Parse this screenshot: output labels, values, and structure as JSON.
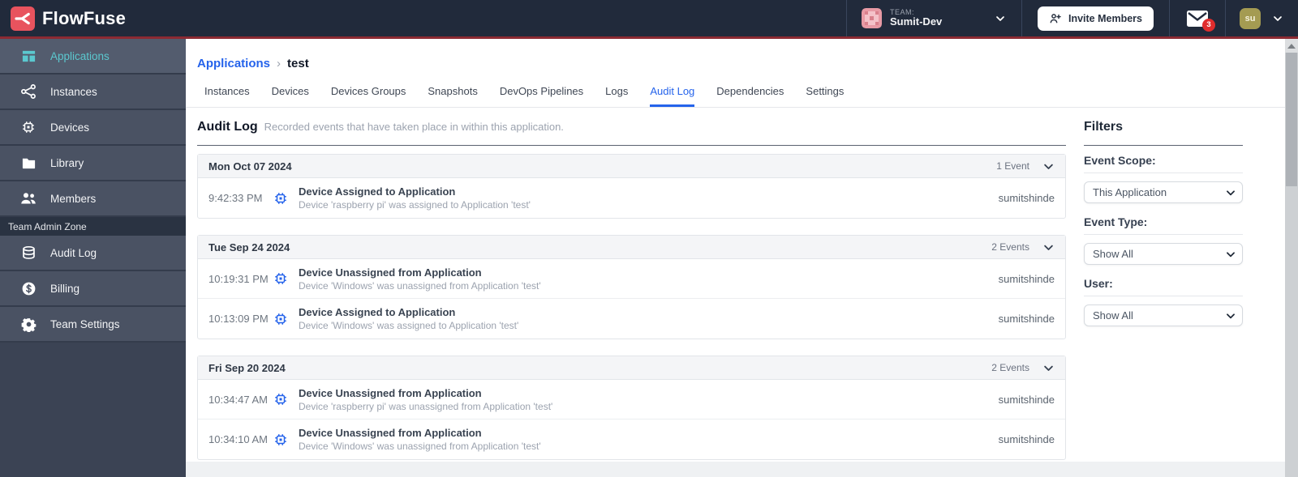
{
  "colors": {
    "accent_blue": "#2563EB",
    "brand_red": "#E8535E",
    "header_red_line": "#8C2A33",
    "active_teal": "#5BC8CF",
    "badge_red": "#E02D2D",
    "avatar_olive": "#A49B52",
    "navbar_bg": "#212A3B",
    "sidebar_item_bg": "#4A5263"
  },
  "header": {
    "logo_text": "FlowFuse",
    "team_label": "TEAM:",
    "team_name": "Sumit-Dev",
    "invite_button": "Invite Members",
    "notification_count": "3",
    "avatar_initials": "su"
  },
  "sidebar": {
    "items": [
      {
        "label": "Applications",
        "icon": "applications-icon",
        "active": true
      },
      {
        "label": "Instances",
        "icon": "instances-icon",
        "active": false
      },
      {
        "label": "Devices",
        "icon": "chip-icon",
        "active": false
      },
      {
        "label": "Library",
        "icon": "folder-icon",
        "active": false
      },
      {
        "label": "Members",
        "icon": "users-icon",
        "active": false
      }
    ],
    "admin_zone_label": "Team Admin Zone",
    "admin_items": [
      {
        "label": "Audit Log",
        "icon": "database-icon",
        "active": false
      },
      {
        "label": "Billing",
        "icon": "dollar-icon",
        "active": false
      },
      {
        "label": "Team Settings",
        "icon": "gear-icon",
        "active": false
      }
    ]
  },
  "breadcrumb": {
    "parent": "Applications",
    "separator": "›",
    "current": "test"
  },
  "tabs": {
    "items": [
      "Instances",
      "Devices",
      "Devices Groups",
      "Snapshots",
      "DevOps Pipelines",
      "Logs",
      "Audit Log",
      "Dependencies",
      "Settings"
    ],
    "active": "Audit Log"
  },
  "audit": {
    "title": "Audit Log",
    "subtitle": "Recorded events that have taken place in within this application.",
    "groups": [
      {
        "date": "Mon Oct 07 2024",
        "count_label": "1 Event",
        "events": [
          {
            "time": "9:42:33 PM",
            "icon": "chip-icon",
            "title": "Device Assigned to Application",
            "description": "Device 'raspberry pi' was assigned to Application 'test'",
            "user": "sumitshinde"
          }
        ]
      },
      {
        "date": "Tue Sep 24 2024",
        "count_label": "2 Events",
        "events": [
          {
            "time": "10:19:31 PM",
            "icon": "chip-icon",
            "title": "Device Unassigned from Application",
            "description": "Device 'Windows' was unassigned from Application 'test'",
            "user": "sumitshinde"
          },
          {
            "time": "10:13:09 PM",
            "icon": "chip-icon",
            "title": "Device Assigned to Application",
            "description": "Device 'Windows' was assigned to Application 'test'",
            "user": "sumitshinde"
          }
        ]
      },
      {
        "date": "Fri Sep 20 2024",
        "count_label": "2 Events",
        "events": [
          {
            "time": "10:34:47 AM",
            "icon": "chip-icon",
            "title": "Device Unassigned from Application",
            "description": "Device 'raspberry pi' was unassigned from Application 'test'",
            "user": "sumitshinde"
          },
          {
            "time": "10:34:10 AM",
            "icon": "chip-icon",
            "title": "Device Unassigned from Application",
            "description": "Device 'Windows' was unassigned from Application 'test'",
            "user": "sumitshinde"
          }
        ]
      }
    ]
  },
  "filters": {
    "title": "Filters",
    "fields": [
      {
        "label": "Event Scope:",
        "value": "This Application"
      },
      {
        "label": "Event Type:",
        "value": "Show All"
      },
      {
        "label": "User:",
        "value": "Show All"
      }
    ]
  }
}
